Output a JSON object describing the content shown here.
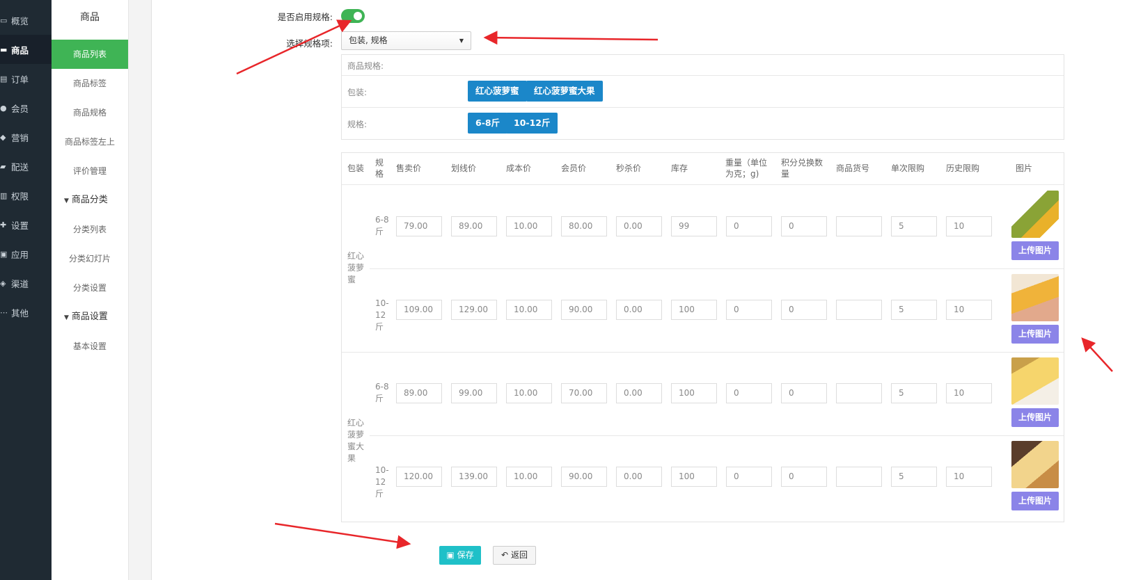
{
  "leftnav": [
    {
      "icon": "monitor-icon",
      "glyph": "▭",
      "label": "概览"
    },
    {
      "icon": "cart-icon",
      "glyph": "▬",
      "label": "商品",
      "active": true
    },
    {
      "icon": "list-icon",
      "glyph": "▤",
      "label": "订单"
    },
    {
      "icon": "users-icon",
      "glyph": "●",
      "label": "会员"
    },
    {
      "icon": "tag-icon",
      "glyph": "◆",
      "label": "营销"
    },
    {
      "icon": "truck-icon",
      "glyph": "▰",
      "label": "配送"
    },
    {
      "icon": "bank-icon",
      "glyph": "▥",
      "label": "权限"
    },
    {
      "icon": "puzzle-icon",
      "glyph": "✚",
      "label": "设置"
    },
    {
      "icon": "apps-icon",
      "glyph": "▣",
      "label": "应用"
    },
    {
      "icon": "cube-icon",
      "glyph": "◈",
      "label": "渠道"
    },
    {
      "icon": "ellipsis-icon",
      "glyph": "⋯",
      "label": "其他"
    }
  ],
  "submenu": {
    "title": "商品",
    "items": [
      {
        "label": "商品列表",
        "type": "sub",
        "active": true
      },
      {
        "label": "商品标签",
        "type": "sub"
      },
      {
        "label": "商品规格",
        "type": "sub"
      },
      {
        "label": "商品标签左上",
        "type": "sub"
      },
      {
        "label": "评价管理",
        "type": "sub"
      },
      {
        "label": "商品分类",
        "type": "group"
      },
      {
        "label": "分类列表",
        "type": "sub"
      },
      {
        "label": "分类幻灯片",
        "type": "sub"
      },
      {
        "label": "分类设置",
        "type": "sub"
      },
      {
        "label": "商品设置",
        "type": "group"
      },
      {
        "label": "基本设置",
        "type": "sub"
      }
    ]
  },
  "form": {
    "enable_spec_label": "是否启用规格:",
    "enable_spec_on": true,
    "select_spec_label": "选择规格项:",
    "select_spec_value": "包装, 规格",
    "spec_box_title": "商品规格:",
    "spec_groups": [
      {
        "label": "包装:",
        "values": [
          "红心菠萝蜜",
          "红心菠萝蜜大果"
        ]
      },
      {
        "label": "规格:",
        "values": [
          "6-8斤",
          "10-12斤"
        ]
      }
    ]
  },
  "sku_table": {
    "headers": [
      "包装",
      "规格",
      "售卖价",
      "划线价",
      "成本价",
      "会员价",
      "秒杀价",
      "库存",
      "重量（单位为克；g)",
      "积分兑换数量",
      "商品货号",
      "单次限购",
      "历史限购",
      "图片"
    ],
    "upload_label": "上传图片",
    "groups": [
      {
        "name": "红心菠萝蜜",
        "rows": [
          {
            "spec": "6-8斤",
            "values": [
              "79.00",
              "89.00",
              "10.00",
              "80.00",
              "0.00",
              "99",
              "0",
              "0",
              "",
              "5",
              "10"
            ],
            "image": "jackfruit-whole"
          },
          {
            "spec": "10-12斤",
            "values": [
              "109.00",
              "129.00",
              "10.00",
              "90.00",
              "0.00",
              "100",
              "0",
              "0",
              "",
              "5",
              "10"
            ],
            "image": "jackfruit-hand"
          }
        ]
      },
      {
        "name": "红心菠萝蜜大果",
        "rows": [
          {
            "spec": "6-8斤",
            "values": [
              "89.00",
              "99.00",
              "10.00",
              "70.00",
              "0.00",
              "100",
              "0",
              "0",
              "",
              "5",
              "10"
            ],
            "image": "jackfruit-plate"
          },
          {
            "spec": "10-12斤",
            "values": [
              "120.00",
              "139.00",
              "10.00",
              "90.00",
              "0.00",
              "100",
              "0",
              "0",
              "",
              "5",
              "10"
            ],
            "image": "jackfruit-cut"
          }
        ]
      }
    ]
  },
  "buttons": {
    "save": "保存",
    "back": "返回"
  },
  "colors": {
    "nav_bg": "#1f2a33",
    "green": "#3fb455",
    "tag_blue": "#1b87c9",
    "upload_purple": "#8b84e8",
    "save_teal": "#1fc0c8",
    "arrow_red": "#e8262a"
  }
}
